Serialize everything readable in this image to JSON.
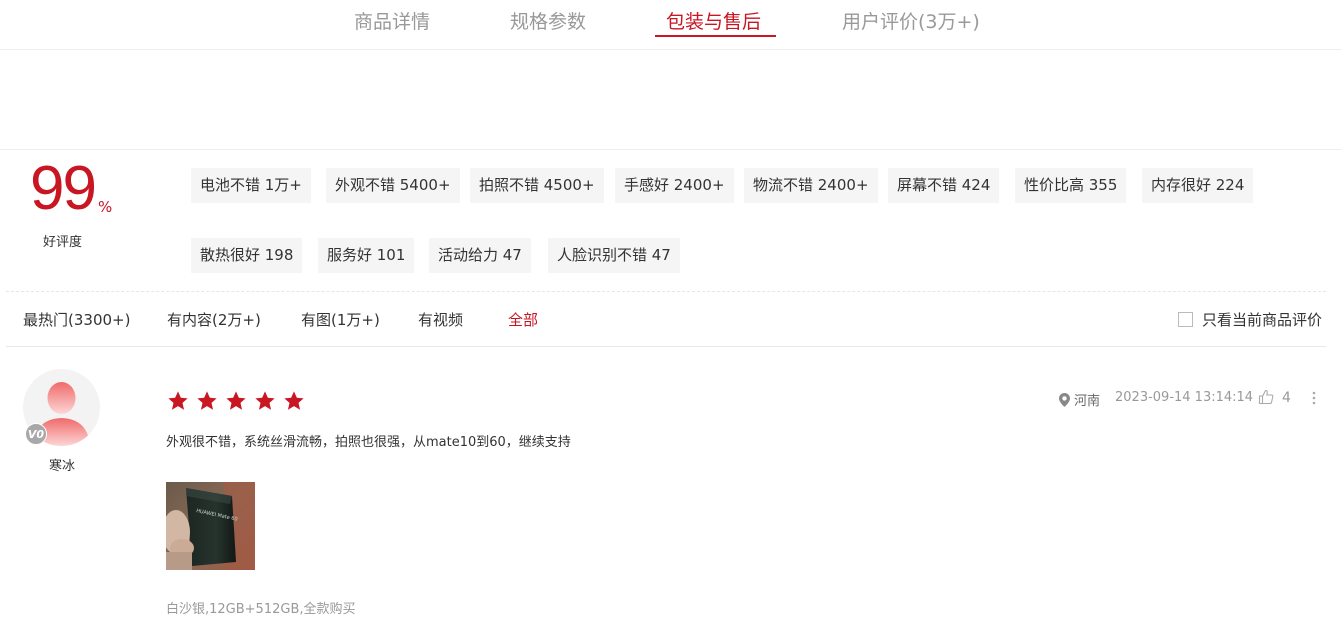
{
  "tabs": [
    {
      "label": "商品详情"
    },
    {
      "label": "规格参数"
    },
    {
      "label": "包装与售后"
    },
    {
      "label": "用户评价(3万+)"
    }
  ],
  "rating": {
    "value": "99",
    "percent_sign": "%",
    "label": "好评度"
  },
  "tags": [
    {
      "label": "电池不错 1万+"
    },
    {
      "label": "外观不错 5400+"
    },
    {
      "label": "拍照不错 4500+"
    },
    {
      "label": "手感好 2400+"
    },
    {
      "label": "物流不错 2400+"
    },
    {
      "label": "屏幕不错 424"
    },
    {
      "label": "性价比高 355"
    },
    {
      "label": "内存很好 224"
    },
    {
      "label": "散热很好 198"
    },
    {
      "label": "服务好 101"
    },
    {
      "label": "活动给力 47"
    },
    {
      "label": "人脸识别不错 47"
    }
  ],
  "filters": [
    {
      "label": "最热门(3300+)"
    },
    {
      "label": "有内容(2万+)"
    },
    {
      "label": "有图(1万+)"
    },
    {
      "label": "有视频"
    },
    {
      "label": "全部"
    }
  ],
  "only_current": {
    "label": "只看当前商品评价",
    "checked": false
  },
  "review": {
    "username": "寒冰",
    "vip_level": "V0",
    "stars": 5,
    "location": "河南",
    "datetime": "2023-09-14 13:14:14",
    "likes": "4",
    "text": "外观很不错，系统丝滑流畅，拍照也很强，从mate10到60，继续支持",
    "photo_text": "HUAWEI Mate 60",
    "spec": "白沙银,12GB+512GB,全款购买"
  },
  "colors": {
    "accent": "#c81623",
    "tag_bg": "#f5f5f5",
    "muted": "#999999"
  }
}
